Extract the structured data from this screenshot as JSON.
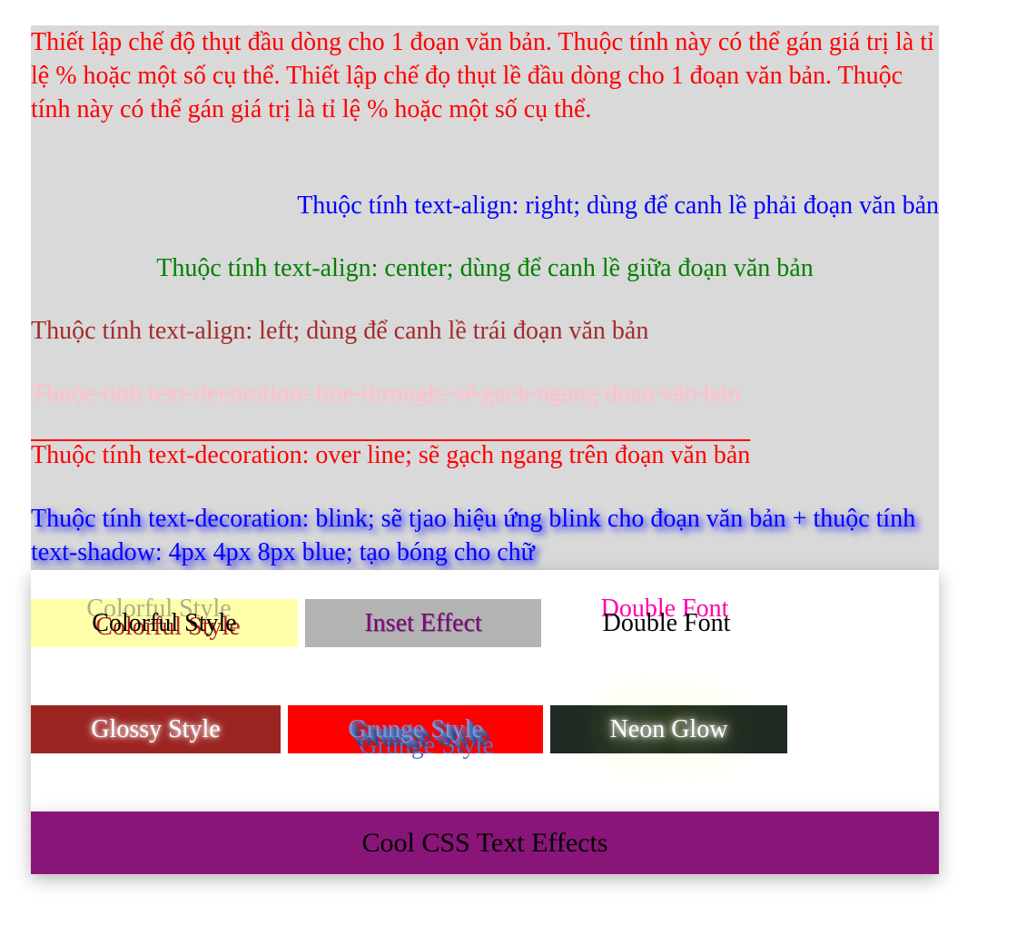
{
  "paragraphs": {
    "indent": "Thiết lập chế độ thụt đầu dòng cho 1 đoạn văn bản. Thuộc tính này có thể gán giá trị là tỉ lệ % hoặc một số cụ thể. Thiết lập chế đọ thụt lề đầu dòng cho 1 đoạn văn bản. Thuộc tính này có thể gán giá trị là tỉ lệ % hoặc một số cụ thể.",
    "align_right": "Thuộc tính text-align: right; dùng để canh lề phải đoạn văn bản",
    "align_center": "Thuộc tính text-align: center; dùng để canh lề giữa đoạn văn bản",
    "align_left": "Thuộc tính text-align: left; dùng để canh lề trái đoạn văn bản",
    "line_through": "Thuộc tính text-decoration: line-through; sẽ gạch ngang đoạn văn bản",
    "overline": "Thuộc tính text-decoration: over line; sẽ gạch ngang trên đoạn văn bản",
    "blink": "Thuộc tính text-decoration: blink; sẽ tjao hiệu ứng blink cho đoạn văn bản + thuộc tính text-shadow: 4px 4px 8px blue; tạo bóng cho chữ"
  },
  "effects": {
    "colorful": "Colorful Style",
    "inset": "Inset Effect",
    "double": "Double Font",
    "glossy": "Glossy Style",
    "grunge": "Grunge Style",
    "neon": "Neon Glow"
  },
  "footer": {
    "title": "Cool CSS Text Effects"
  },
  "colors": {
    "panel_bg": "#d9d9d9",
    "red": "#ff0000",
    "blue": "#0000ff",
    "green": "#008000",
    "brown": "#a52a2a",
    "pink": "#ffc0cb",
    "footer_bg": "#8a1578"
  }
}
